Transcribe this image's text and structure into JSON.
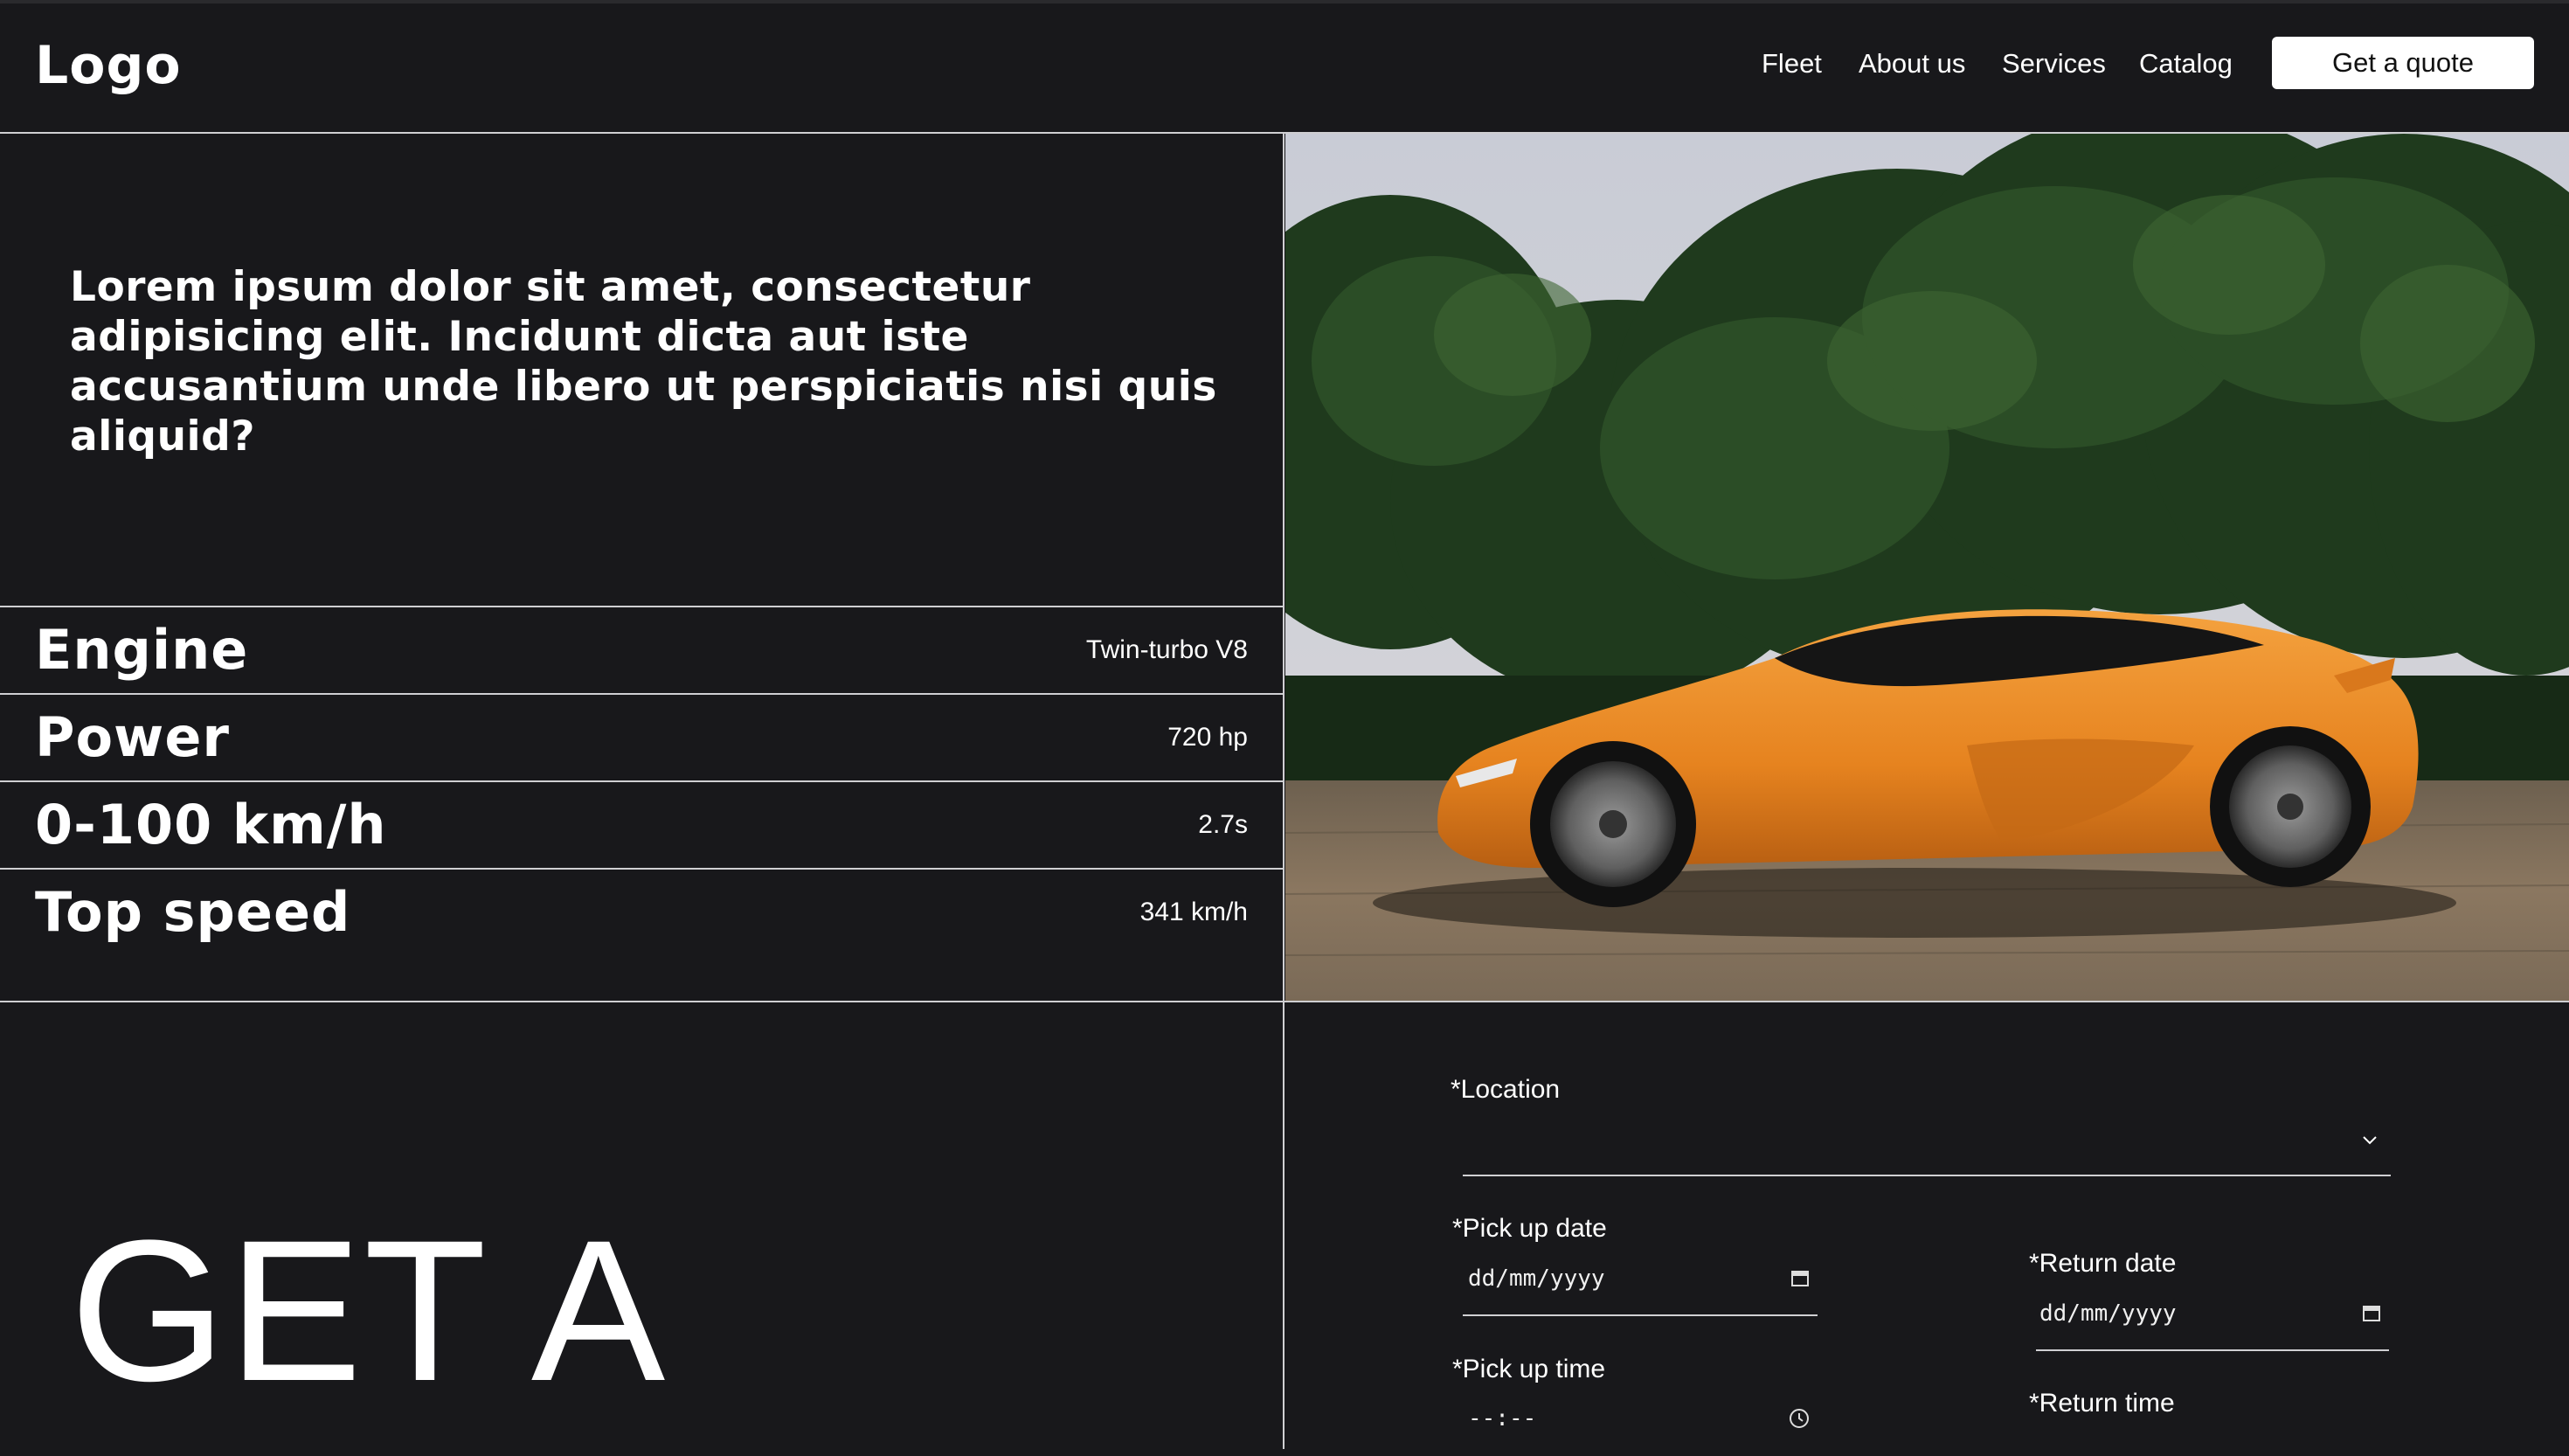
{
  "header": {
    "logo": "Logo",
    "nav": [
      "Fleet",
      "About us",
      "Services",
      "Catalog"
    ],
    "cta": "Get a quote"
  },
  "intro": {
    "text": "Lorem ipsum dolor sit amet, consectetur adipisicing elit. Incidunt dicta aut iste accusantium unde libero ut perspiciatis nisi quis aliquid?"
  },
  "specs": [
    {
      "label": "Engine",
      "value": "Twin-turbo V8"
    },
    {
      "label": "Power",
      "value": "720 hp"
    },
    {
      "label": "0-100 km/h",
      "value": "2.7s"
    },
    {
      "label": "Top speed",
      "value": "341 km/h"
    }
  ],
  "hero": {
    "heading": "GET A",
    "image_alt": "Orange sports car parked in front of green bushes"
  },
  "form": {
    "location_label": "*Location",
    "pickup_date_label": "*Pick up date",
    "pickup_date_placeholder": "dd/mm/yyyy",
    "return_date_label": "*Return date",
    "return_date_placeholder": "dd/mm/yyyy",
    "pickup_time_label": "*Pick up time",
    "pickup_time_placeholder": "--:--",
    "return_time_label": "*Return time"
  },
  "colors": {
    "background": "#18181b",
    "accent_car": "#e88a2a",
    "text": "#ffffff"
  }
}
